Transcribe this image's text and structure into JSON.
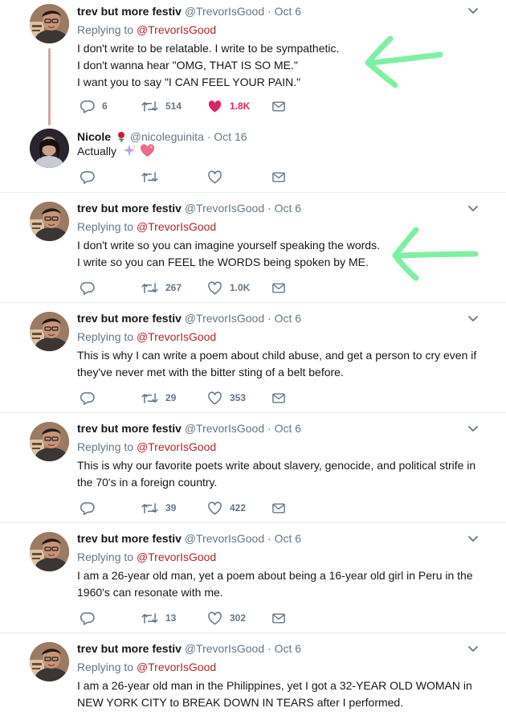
{
  "tweets": [
    {
      "name": "trev but more festiv",
      "handle": "@TrevorIsGood",
      "time": "Oct 6",
      "replying_prefix": "Replying to",
      "replying_to": "@TrevorIsGood",
      "lines": [
        "I don't write to be relatable. I write to be sympathetic.",
        "I don't wanna hear \"OMG, THAT IS SO ME.\"",
        "I want you to say \"I CAN FEEL YOUR PAIN.\""
      ],
      "replies": "6",
      "retweets": "514",
      "likes": "1.8K",
      "liked": true
    },
    {
      "name": "Nicole",
      "handle": "@nicoleguinita",
      "time": "Oct 16",
      "lines": [
        "Actually"
      ],
      "replies": "",
      "retweets": "",
      "likes": "",
      "liked": false
    },
    {
      "name": "trev but more festiv",
      "handle": "@TrevorIsGood",
      "time": "Oct 6",
      "replying_prefix": "Replying to",
      "replying_to": "@TrevorIsGood",
      "lines": [
        "I don't write so you can imagine yourself speaking the words.",
        "I write so you can FEEL the WORDS being spoken by ME."
      ],
      "replies": "",
      "retweets": "267",
      "likes": "1.0K",
      "liked": false
    },
    {
      "name": "trev but more festiv",
      "handle": "@TrevorIsGood",
      "time": "Oct 6",
      "replying_prefix": "Replying to",
      "replying_to": "@TrevorIsGood",
      "lines": [
        "This is why I can write a poem about child abuse, and get a person to cry even if",
        "they've never met with the bitter sting of a belt before."
      ],
      "replies": "",
      "retweets": "29",
      "likes": "353",
      "liked": false
    },
    {
      "name": "trev but more festiv",
      "handle": "@TrevorIsGood",
      "time": "Oct 6",
      "replying_prefix": "Replying to",
      "replying_to": "@TrevorIsGood",
      "lines": [
        "This is why our favorite poets write about slavery, genocide, and political strife in",
        "the 70's in a foreign country."
      ],
      "replies": "",
      "retweets": "39",
      "likes": "422",
      "liked": false
    },
    {
      "name": "trev but more festiv",
      "handle": "@TrevorIsGood",
      "time": "Oct 6",
      "replying_prefix": "Replying to",
      "replying_to": "@TrevorIsGood",
      "lines": [
        "I am a 26-year old man, yet a poem about being a 16-year old girl in Peru in the",
        "1960's can resonate with me."
      ],
      "replies": "",
      "retweets": "13",
      "likes": "302",
      "liked": false
    },
    {
      "name": "trev but more festiv",
      "handle": "@TrevorIsGood",
      "time": "Oct 6",
      "replying_prefix": "Replying to",
      "replying_to": "@TrevorIsGood",
      "lines": [
        "I am a 26-year old man in the Philippines, yet I got a 32-YEAR OLD WOMAN in",
        "NEW YORK CITY to BREAK DOWN IN TEARS after I performed."
      ]
    }
  ],
  "separator": "·",
  "colors": {
    "accent_mention": "#b0262e",
    "like_active": "#e0245e",
    "muted": "#657786",
    "arrow_annotation": "#7ef0a4"
  },
  "icons": [
    "reply-icon",
    "retweet-icon",
    "like-icon",
    "dm-icon",
    "chevron-down-icon",
    "rose-emoji",
    "sparkles-emoji",
    "sparkling-heart-emoji"
  ]
}
